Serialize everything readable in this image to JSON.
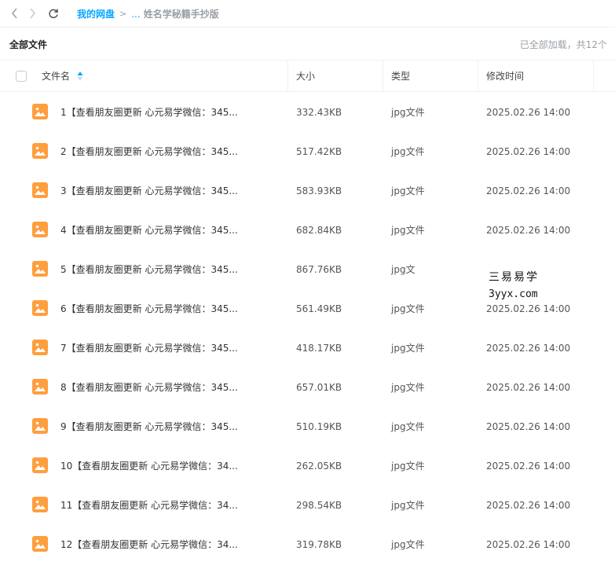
{
  "nav": {
    "back_icon": "chevron-left-icon",
    "forward_icon": "chevron-right-icon",
    "refresh_icon": "refresh-icon"
  },
  "breadcrumb": {
    "root": "我的网盘",
    "separator": ">",
    "ellipsis": "...",
    "current": "姓名学秘籍手抄版"
  },
  "list": {
    "title": "全部文件",
    "status": "已全部加载，共12个"
  },
  "table": {
    "headers": {
      "name": "文件名",
      "size": "大小",
      "type": "类型",
      "modified": "修改时间"
    },
    "rows": [
      {
        "name": "1【查看朋友圈更新 心元易学微信：345...",
        "size": "332.43KB",
        "type": "jpg文件",
        "modified": "2025.02.26 14:00"
      },
      {
        "name": "2【查看朋友圈更新 心元易学微信：345...",
        "size": "517.42KB",
        "type": "jpg文件",
        "modified": "2025.02.26 14:00"
      },
      {
        "name": "3【查看朋友圈更新 心元易学微信：345...",
        "size": "583.93KB",
        "type": "jpg文件",
        "modified": "2025.02.26 14:00"
      },
      {
        "name": "4【查看朋友圈更新 心元易学微信：345...",
        "size": "682.84KB",
        "type": "jpg文件",
        "modified": "2025.02.26 14:00"
      },
      {
        "name": "5【查看朋友圈更新 心元易学微信：345...",
        "size": "867.76KB",
        "type": "jpg文",
        "modified": ""
      },
      {
        "name": "6【查看朋友圈更新 心元易学微信：345...",
        "size": "561.49KB",
        "type": "jpg文件",
        "modified": "2025.02.26 14:00"
      },
      {
        "name": "7【查看朋友圈更新 心元易学微信：345...",
        "size": "418.17KB",
        "type": "jpg文件",
        "modified": "2025.02.26 14:00"
      },
      {
        "name": "8【查看朋友圈更新 心元易学微信：345...",
        "size": "657.01KB",
        "type": "jpg文件",
        "modified": "2025.02.26 14:00"
      },
      {
        "name": "9【查看朋友圈更新 心元易学微信：345...",
        "size": "510.19KB",
        "type": "jpg文件",
        "modified": "2025.02.26 14:00"
      },
      {
        "name": "10【查看朋友圈更新 心元易学微信：34...",
        "size": "262.05KB",
        "type": "jpg文件",
        "modified": "2025.02.26 14:00"
      },
      {
        "name": "11【查看朋友圈更新 心元易学微信：34...",
        "size": "298.54KB",
        "type": "jpg文件",
        "modified": "2025.02.26 14:00"
      },
      {
        "name": "12【查看朋友圈更新 心元易学微信：34...",
        "size": "319.78KB",
        "type": "jpg文件",
        "modified": "2025.02.26 14:00"
      }
    ]
  },
  "watermark": {
    "line1": "三易易学",
    "line2": "3yyx.com"
  },
  "colors": {
    "accent": "#06a7ff",
    "file_icon": "#ff9e3d",
    "muted_text": "#9aa0a6"
  }
}
